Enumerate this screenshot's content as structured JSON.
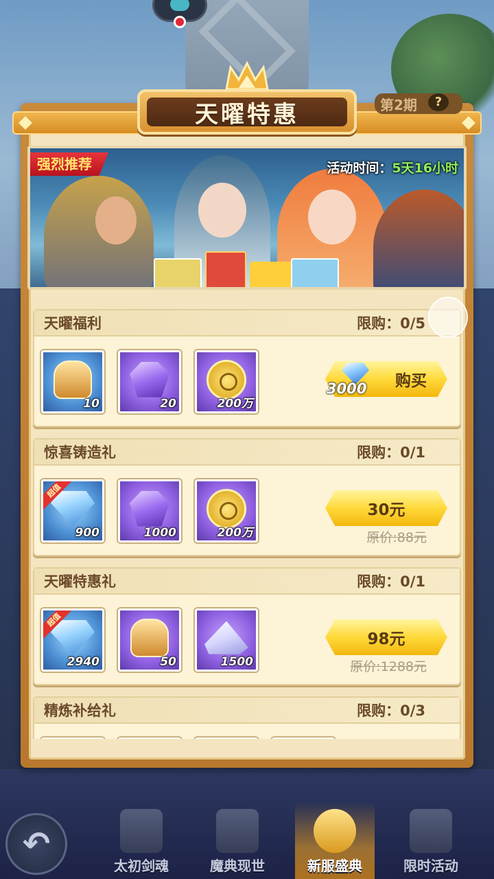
{
  "header": {
    "title": "天曜特惠",
    "issue_label": "第2期",
    "help_label": "?"
  },
  "banner": {
    "badge": "强烈推荐",
    "time_label": "活动时间：",
    "time_value": "5天16小时"
  },
  "offers": [
    {
      "name": "天曜福利",
      "limit": "限购：0/5",
      "items": [
        {
          "icon": "golden-helmet-icon",
          "qty": "10"
        },
        {
          "icon": "purple-gem-icon",
          "qty": "20"
        },
        {
          "icon": "gold-coin-icon",
          "qty": "200万"
        }
      ],
      "cost": "3000",
      "button": "购买",
      "original_price": ""
    },
    {
      "name": "惊喜铸造礼",
      "limit": "限购：0/1",
      "items": [
        {
          "icon": "diamond-icon",
          "qty": "900",
          "tag": "超值"
        },
        {
          "icon": "purple-gem-icon",
          "qty": "1000"
        },
        {
          "icon": "gold-coin-icon",
          "qty": "200万"
        }
      ],
      "button": "30元",
      "original_price": "原价:88元"
    },
    {
      "name": "天曜特惠礼",
      "limit": "限购：0/1",
      "items": [
        {
          "icon": "diamond-icon",
          "qty": "2940",
          "tag": "超值"
        },
        {
          "icon": "golden-helmet-icon",
          "qty": "50"
        },
        {
          "icon": "crystal-shard-icon",
          "qty": "1500"
        }
      ],
      "button": "98元",
      "original_price": "原价:1288元"
    },
    {
      "name": "精炼补给礼",
      "limit": "限购：0/3"
    }
  ],
  "nav": {
    "tabs": [
      {
        "label": "太初剑魂",
        "icon": "sword-soul-icon"
      },
      {
        "label": "魔典现世",
        "icon": "magic-tome-icon"
      },
      {
        "label": "新服盛典",
        "icon": "star-laurel-icon",
        "active": true
      },
      {
        "label": "限时活动",
        "icon": "hourglass-icon"
      }
    ]
  },
  "colors": {
    "panel": "#c98a3a",
    "card_bg": "#fdf3d6",
    "button": "#ffd93a",
    "time_value": "#8ff05c",
    "badge": "#e8343a"
  }
}
